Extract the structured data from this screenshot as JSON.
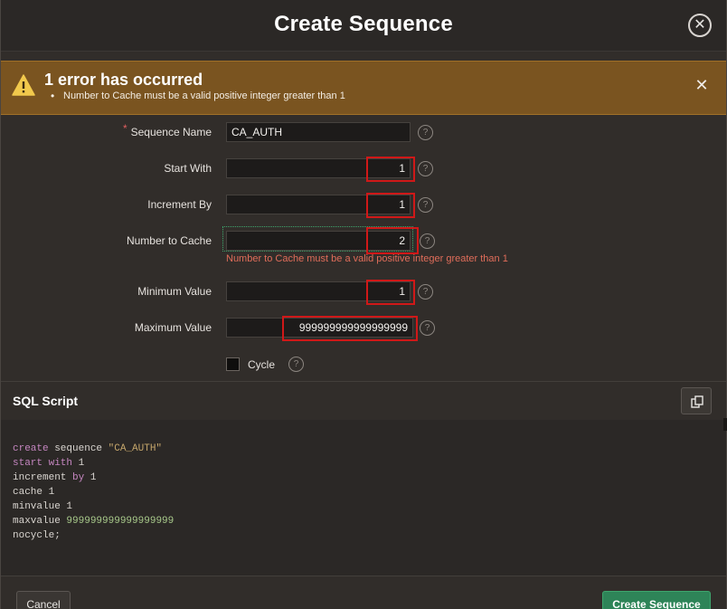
{
  "dialog": {
    "title": "Create Sequence",
    "close_icon": "close-icon"
  },
  "alert": {
    "icon": "warning-icon",
    "title": "1 error has occurred",
    "messages": [
      "Number to Cache must be a valid positive integer greater than 1"
    ],
    "close_icon": "close-icon"
  },
  "form": {
    "sequence_name": {
      "label": "Sequence Name",
      "value": "CA_AUTH",
      "required": true
    },
    "start_with": {
      "label": "Start With",
      "value": "1"
    },
    "increment_by": {
      "label": "Increment By",
      "value": "1"
    },
    "number_to_cache": {
      "label": "Number to Cache",
      "value": "2",
      "error": "Number to Cache must be a valid positive integer greater than 1"
    },
    "minimum_value": {
      "label": "Minimum Value",
      "value": "1"
    },
    "maximum_value": {
      "label": "Maximum Value",
      "value": "999999999999999999"
    },
    "cycle": {
      "label": "Cycle",
      "checked": false
    },
    "help_icon": "help-icon"
  },
  "sql": {
    "title": "SQL Script",
    "copy_icon": "copy-icon",
    "lines": [
      {
        "kw": "create",
        "rest": " sequence ",
        "str": "\"CA_AUTH\""
      },
      {
        "kw": "start with",
        "rest": " 1"
      },
      {
        "pre": "increment ",
        "kw": "by",
        "rest": " 1"
      },
      {
        "pre": "cache 1"
      },
      {
        "pre": "minvalue 1"
      },
      {
        "pre": "maxvalue ",
        "num": "999999999999999999"
      },
      {
        "pre": "nocycle;"
      }
    ]
  },
  "footer": {
    "cancel_label": "Cancel",
    "create_label": "Create Sequence"
  },
  "colors": {
    "alert_bg": "#7a5420",
    "error_text": "#e06d5a",
    "highlight_box": "#d01818",
    "primary_button": "#2e8458"
  }
}
